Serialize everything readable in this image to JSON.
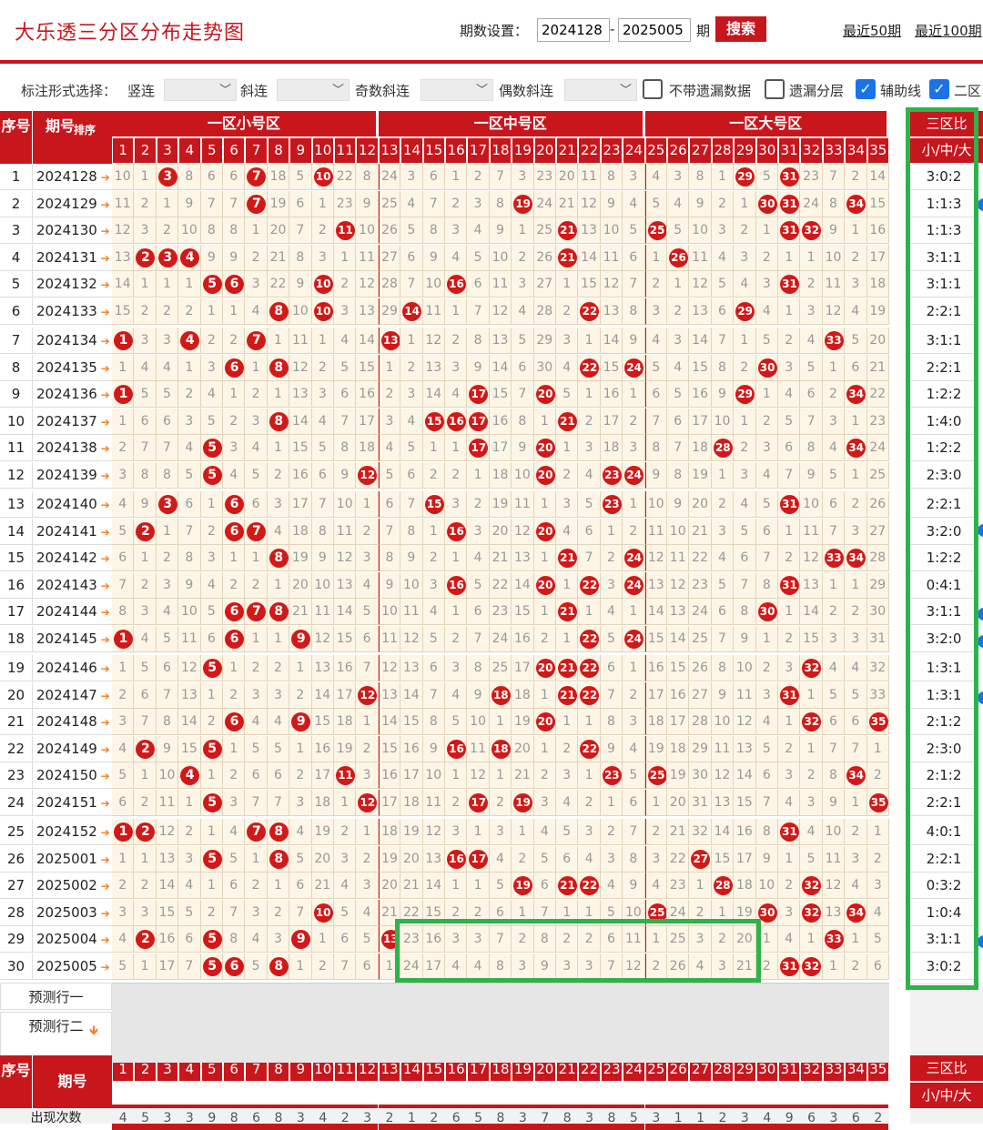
{
  "title": "大乐透三分区分布走势图",
  "period_setting_label": "期数设置：",
  "period_from": "2024128",
  "period_to": "2025005",
  "period_unit": "期",
  "search_button": "搜索",
  "recent_50": "最近50期",
  "recent_100": "最近100期",
  "filter": {
    "label": "标注形式选择：",
    "vertical": "竖连",
    "diagonal": "斜连",
    "odd_diag": "奇数斜连",
    "even_diag": "偶数斜连",
    "no_miss": "不带遗漏数据",
    "miss_layer": "遗漏分层",
    "aux_line": "辅助线",
    "zone2": "二区"
  },
  "headers": {
    "seq": "序号",
    "issue": "期号",
    "sort": "排序",
    "zone_small": "一区小号区",
    "zone_mid": "一区中号区",
    "zone_big": "一区大号区",
    "ratio_title": "三区比",
    "ratio_sub": "小/中/大",
    "predict1": "预测行一",
    "predict2": "预测行二",
    "appear_count": "出现次数"
  },
  "appear_counts": [
    "4",
    "5",
    "3",
    "3",
    "9",
    "8",
    "6",
    "8",
    "3",
    "4",
    "2",
    "3",
    "2",
    "1",
    "2",
    "6",
    "5",
    "8",
    "3",
    "7",
    "8",
    "3",
    "8",
    "5",
    "3",
    "1",
    "1",
    "2",
    "3",
    "4",
    "9",
    "6",
    "3",
    "6",
    "2"
  ],
  "rows": [
    {
      "seq": "1",
      "issue": "2024128",
      "ratio": "3:0:2",
      "cells": [
        10,
        1,
        "3",
        8,
        6,
        6,
        "7",
        18,
        5,
        "10",
        22,
        8,
        24,
        3,
        6,
        1,
        2,
        7,
        3,
        23,
        20,
        11,
        8,
        3,
        4,
        3,
        8,
        1,
        "29",
        5,
        "31",
        23,
        7,
        2,
        14
      ]
    },
    {
      "seq": "2",
      "issue": "2024129",
      "ratio": "1:1:3",
      "cells": [
        11,
        2,
        1,
        9,
        7,
        7,
        "7",
        19,
        6,
        1,
        23,
        9,
        25,
        4,
        7,
        2,
        3,
        8,
        "19",
        24,
        21,
        12,
        9,
        4,
        5,
        4,
        9,
        2,
        1,
        "30",
        "31",
        24,
        8,
        "34",
        15
      ]
    },
    {
      "seq": "3",
      "issue": "2024130",
      "ratio": "1:1:3",
      "cells": [
        12,
        3,
        2,
        10,
        8,
        8,
        1,
        20,
        7,
        2,
        "11",
        10,
        26,
        5,
        8,
        3,
        4,
        9,
        1,
        25,
        "21",
        13,
        10,
        5,
        "25",
        5,
        10,
        3,
        2,
        1,
        "31",
        "32",
        9,
        1,
        16
      ]
    },
    {
      "seq": "4",
      "issue": "2024131",
      "ratio": "3:1:1",
      "cells": [
        13,
        "2",
        "3",
        "4",
        9,
        9,
        2,
        21,
        8,
        3,
        1,
        11,
        27,
        6,
        9,
        4,
        5,
        10,
        2,
        26,
        "21",
        14,
        11,
        6,
        1,
        "26",
        11,
        4,
        3,
        2,
        1,
        1,
        10,
        2,
        17
      ]
    },
    {
      "seq": "5",
      "issue": "2024132",
      "ratio": "3:1:1",
      "cells": [
        14,
        1,
        1,
        1,
        "5",
        "6",
        3,
        22,
        9,
        "10",
        2,
        12,
        28,
        7,
        10,
        "16",
        6,
        11,
        3,
        27,
        1,
        15,
        12,
        7,
        2,
        1,
        12,
        5,
        4,
        3,
        "31",
        2,
        11,
        3,
        18
      ]
    },
    {
      "seq": "6",
      "issue": "2024133",
      "ratio": "2:2:1",
      "cells": [
        15,
        2,
        2,
        2,
        1,
        1,
        4,
        "8",
        10,
        "10",
        3,
        13,
        29,
        "14",
        11,
        1,
        7,
        12,
        4,
        28,
        2,
        "22",
        13,
        8,
        3,
        2,
        13,
        6,
        "29",
        4,
        1,
        3,
        12,
        4,
        19
      ]
    },
    {
      "seq": "7",
      "issue": "2024134",
      "ratio": "3:1:1",
      "cells": [
        "1",
        3,
        3,
        "4",
        2,
        2,
        "7",
        1,
        11,
        1,
        4,
        14,
        "13",
        1,
        12,
        2,
        8,
        13,
        5,
        29,
        3,
        1,
        14,
        9,
        4,
        3,
        14,
        7,
        1,
        5,
        2,
        4,
        "33",
        5,
        20
      ]
    },
    {
      "seq": "8",
      "issue": "2024135",
      "ratio": "2:2:1",
      "cells": [
        1,
        4,
        4,
        1,
        3,
        "6",
        1,
        "8",
        12,
        2,
        5,
        15,
        1,
        2,
        13,
        3,
        9,
        14,
        6,
        30,
        4,
        "22",
        15,
        "24",
        5,
        4,
        15,
        8,
        2,
        "30",
        3,
        5,
        1,
        6,
        21
      ]
    },
    {
      "seq": "9",
      "issue": "2024136",
      "ratio": "1:2:2",
      "cells": [
        "1",
        5,
        5,
        2,
        4,
        1,
        2,
        1,
        13,
        3,
        6,
        16,
        2,
        3,
        14,
        4,
        "17",
        15,
        7,
        "20",
        5,
        1,
        16,
        1,
        6,
        5,
        16,
        9,
        "29",
        1,
        4,
        6,
        2,
        "34",
        22
      ]
    },
    {
      "seq": "10",
      "issue": "2024137",
      "ratio": "1:4:0",
      "cells": [
        1,
        6,
        6,
        3,
        5,
        2,
        3,
        "8",
        14,
        4,
        7,
        17,
        3,
        4,
        "15",
        "16",
        "17",
        16,
        8,
        1,
        "21",
        2,
        17,
        2,
        7,
        6,
        17,
        10,
        1,
        2,
        5,
        7,
        3,
        1,
        23
      ]
    },
    {
      "seq": "11",
      "issue": "2024138",
      "ratio": "1:2:2",
      "cells": [
        2,
        7,
        7,
        4,
        "5",
        3,
        4,
        1,
        15,
        5,
        8,
        18,
        4,
        5,
        1,
        1,
        "17",
        17,
        9,
        "20",
        1,
        3,
        18,
        3,
        8,
        7,
        18,
        "28",
        2,
        3,
        6,
        8,
        4,
        "34",
        24
      ]
    },
    {
      "seq": "12",
      "issue": "2024139",
      "ratio": "2:3:0",
      "cells": [
        3,
        8,
        8,
        5,
        "5",
        4,
        5,
        2,
        16,
        6,
        9,
        "12",
        5,
        6,
        2,
        2,
        1,
        18,
        10,
        "20",
        2,
        4,
        "23",
        "24",
        9,
        8,
        19,
        1,
        3,
        4,
        7,
        9,
        5,
        1,
        25
      ]
    },
    {
      "seq": "13",
      "issue": "2024140",
      "ratio": "2:2:1",
      "cells": [
        4,
        9,
        "3",
        6,
        1,
        "6",
        6,
        3,
        17,
        7,
        10,
        1,
        6,
        7,
        "15",
        3,
        2,
        19,
        11,
        1,
        3,
        5,
        "23",
        1,
        10,
        9,
        20,
        2,
        4,
        5,
        "31",
        10,
        6,
        2,
        26
      ]
    },
    {
      "seq": "14",
      "issue": "2024141",
      "ratio": "3:2:0",
      "cells": [
        5,
        "2",
        1,
        7,
        2,
        "6",
        "7",
        4,
        18,
        8,
        11,
        2,
        7,
        8,
        1,
        "16",
        3,
        20,
        12,
        "20",
        4,
        6,
        1,
        2,
        11,
        10,
        21,
        3,
        5,
        6,
        1,
        11,
        7,
        3,
        27
      ]
    },
    {
      "seq": "15",
      "issue": "2024142",
      "ratio": "1:2:2",
      "cells": [
        6,
        1,
        2,
        8,
        3,
        1,
        1,
        "8",
        19,
        9,
        12,
        3,
        8,
        9,
        2,
        1,
        4,
        21,
        13,
        1,
        "21",
        7,
        2,
        "24",
        12,
        11,
        22,
        4,
        6,
        7,
        2,
        12,
        "33",
        "34",
        28
      ]
    },
    {
      "seq": "16",
      "issue": "2024143",
      "ratio": "0:4:1",
      "cells": [
        7,
        2,
        3,
        9,
        4,
        2,
        2,
        1,
        20,
        10,
        13,
        4,
        9,
        10,
        3,
        "16",
        5,
        22,
        14,
        "20",
        1,
        "22",
        3,
        "24",
        13,
        12,
        23,
        5,
        7,
        8,
        "31",
        13,
        1,
        1,
        29
      ]
    },
    {
      "seq": "17",
      "issue": "2024144",
      "ratio": "3:1:1",
      "cells": [
        8,
        3,
        4,
        10,
        5,
        "6",
        "7",
        "8",
        21,
        11,
        14,
        5,
        10,
        11,
        4,
        1,
        6,
        23,
        15,
        1,
        "21",
        1,
        4,
        1,
        14,
        13,
        24,
        6,
        8,
        "30",
        1,
        14,
        2,
        2,
        30
      ]
    },
    {
      "seq": "18",
      "issue": "2024145",
      "ratio": "3:2:0",
      "cells": [
        "1",
        4,
        5,
        11,
        6,
        "6",
        1,
        1,
        "9",
        12,
        15,
        6,
        11,
        12,
        5,
        2,
        7,
        24,
        16,
        2,
        1,
        "22",
        5,
        "24",
        15,
        14,
        25,
        7,
        9,
        1,
        2,
        15,
        3,
        3,
        31
      ]
    },
    {
      "seq": "19",
      "issue": "2024146",
      "ratio": "1:3:1",
      "cells": [
        1,
        5,
        6,
        12,
        "5",
        1,
        2,
        2,
        1,
        13,
        16,
        7,
        12,
        13,
        6,
        3,
        8,
        25,
        17,
        "20",
        "21",
        "22",
        6,
        1,
        16,
        15,
        26,
        8,
        10,
        2,
        3,
        "32",
        4,
        4,
        32
      ]
    },
    {
      "seq": "20",
      "issue": "2024147",
      "ratio": "1:3:1",
      "cells": [
        2,
        6,
        7,
        13,
        1,
        2,
        3,
        3,
        2,
        14,
        17,
        "12",
        13,
        14,
        7,
        4,
        9,
        "18",
        18,
        1,
        "21",
        "22",
        7,
        2,
        17,
        16,
        27,
        9,
        11,
        3,
        "31",
        1,
        5,
        5,
        33
      ]
    },
    {
      "seq": "21",
      "issue": "2024148",
      "ratio": "2:1:2",
      "cells": [
        3,
        7,
        8,
        14,
        2,
        "6",
        4,
        4,
        "9",
        15,
        18,
        1,
        14,
        15,
        8,
        5,
        10,
        1,
        19,
        "20",
        1,
        1,
        8,
        3,
        18,
        17,
        28,
        10,
        12,
        4,
        1,
        "32",
        6,
        6,
        "35"
      ]
    },
    {
      "seq": "22",
      "issue": "2024149",
      "ratio": "2:3:0",
      "cells": [
        4,
        "2",
        9,
        15,
        "5",
        1,
        5,
        5,
        1,
        16,
        19,
        2,
        15,
        16,
        9,
        "16",
        11,
        "18",
        20,
        1,
        2,
        "22",
        9,
        4,
        19,
        18,
        29,
        11,
        13,
        5,
        2,
        1,
        7,
        7,
        1
      ]
    },
    {
      "seq": "23",
      "issue": "2024150",
      "ratio": "2:1:2",
      "cells": [
        5,
        1,
        10,
        "4",
        1,
        2,
        6,
        6,
        2,
        17,
        "11",
        3,
        16,
        17,
        10,
        1,
        12,
        1,
        21,
        2,
        3,
        1,
        "23",
        5,
        "25",
        19,
        30,
        12,
        14,
        6,
        3,
        2,
        8,
        "34",
        2
      ]
    },
    {
      "seq": "24",
      "issue": "2024151",
      "ratio": "2:2:1",
      "cells": [
        6,
        2,
        11,
        1,
        "5",
        3,
        7,
        7,
        3,
        18,
        1,
        "12",
        17,
        18,
        11,
        2,
        "17",
        2,
        "19",
        3,
        4,
        2,
        1,
        6,
        1,
        20,
        31,
        13,
        15,
        7,
        4,
        3,
        9,
        1,
        "35"
      ]
    },
    {
      "seq": "25",
      "issue": "2024152",
      "ratio": "4:0:1",
      "cells": [
        "1",
        "2",
        12,
        2,
        1,
        4,
        "7",
        "8",
        4,
        19,
        2,
        1,
        18,
        19,
        12,
        3,
        1,
        3,
        1,
        4,
        5,
        3,
        2,
        7,
        2,
        21,
        32,
        14,
        16,
        8,
        "31",
        4,
        10,
        2,
        1
      ]
    },
    {
      "seq": "26",
      "issue": "2025001",
      "ratio": "2:2:1",
      "cells": [
        1,
        1,
        13,
        3,
        "5",
        5,
        1,
        "8",
        5,
        20,
        3,
        2,
        19,
        20,
        13,
        "16",
        "17",
        4,
        2,
        5,
        6,
        4,
        3,
        8,
        3,
        22,
        "27",
        15,
        17,
        9,
        1,
        5,
        11,
        3,
        2
      ]
    },
    {
      "seq": "27",
      "issue": "2025002",
      "ratio": "0:3:2",
      "cells": [
        2,
        2,
        14,
        4,
        1,
        6,
        2,
        1,
        6,
        21,
        4,
        3,
        20,
        21,
        14,
        1,
        1,
        5,
        "19",
        6,
        "21",
        "22",
        4,
        9,
        4,
        23,
        1,
        "28",
        18,
        10,
        2,
        "32",
        12,
        4,
        3
      ]
    },
    {
      "seq": "28",
      "issue": "2025003",
      "ratio": "1:0:4",
      "cells": [
        3,
        3,
        15,
        5,
        2,
        7,
        3,
        2,
        7,
        "10",
        5,
        4,
        21,
        22,
        15,
        2,
        2,
        6,
        1,
        7,
        1,
        1,
        5,
        10,
        "25",
        24,
        2,
        1,
        19,
        "30",
        3,
        "32",
        13,
        "34",
        4
      ]
    },
    {
      "seq": "29",
      "issue": "2025004",
      "ratio": "3:1:1",
      "cells": [
        4,
        "2",
        16,
        6,
        "5",
        8,
        4,
        3,
        "9",
        1,
        6,
        5,
        "13",
        23,
        16,
        3,
        3,
        7,
        2,
        8,
        2,
        2,
        6,
        11,
        1,
        25,
        3,
        2,
        20,
        1,
        4,
        1,
        "33",
        1,
        5
      ]
    },
    {
      "seq": "30",
      "issue": "2025005",
      "ratio": "3:0:2",
      "cells": [
        5,
        1,
        17,
        7,
        "5",
        "6",
        5,
        "8",
        1,
        2,
        7,
        6,
        1,
        24,
        17,
        4,
        4,
        8,
        3,
        9,
        3,
        3,
        7,
        12,
        2,
        26,
        4,
        3,
        21,
        2,
        "31",
        "32",
        1,
        2,
        6
      ]
    }
  ],
  "colors": {
    "red": "#c8161d",
    "ball": "#d31818",
    "green": "#2eb34a",
    "cell_bg": "#fdf5e6",
    "arrow": "#ff7a1a",
    "checkbox": "#1a73e8"
  }
}
